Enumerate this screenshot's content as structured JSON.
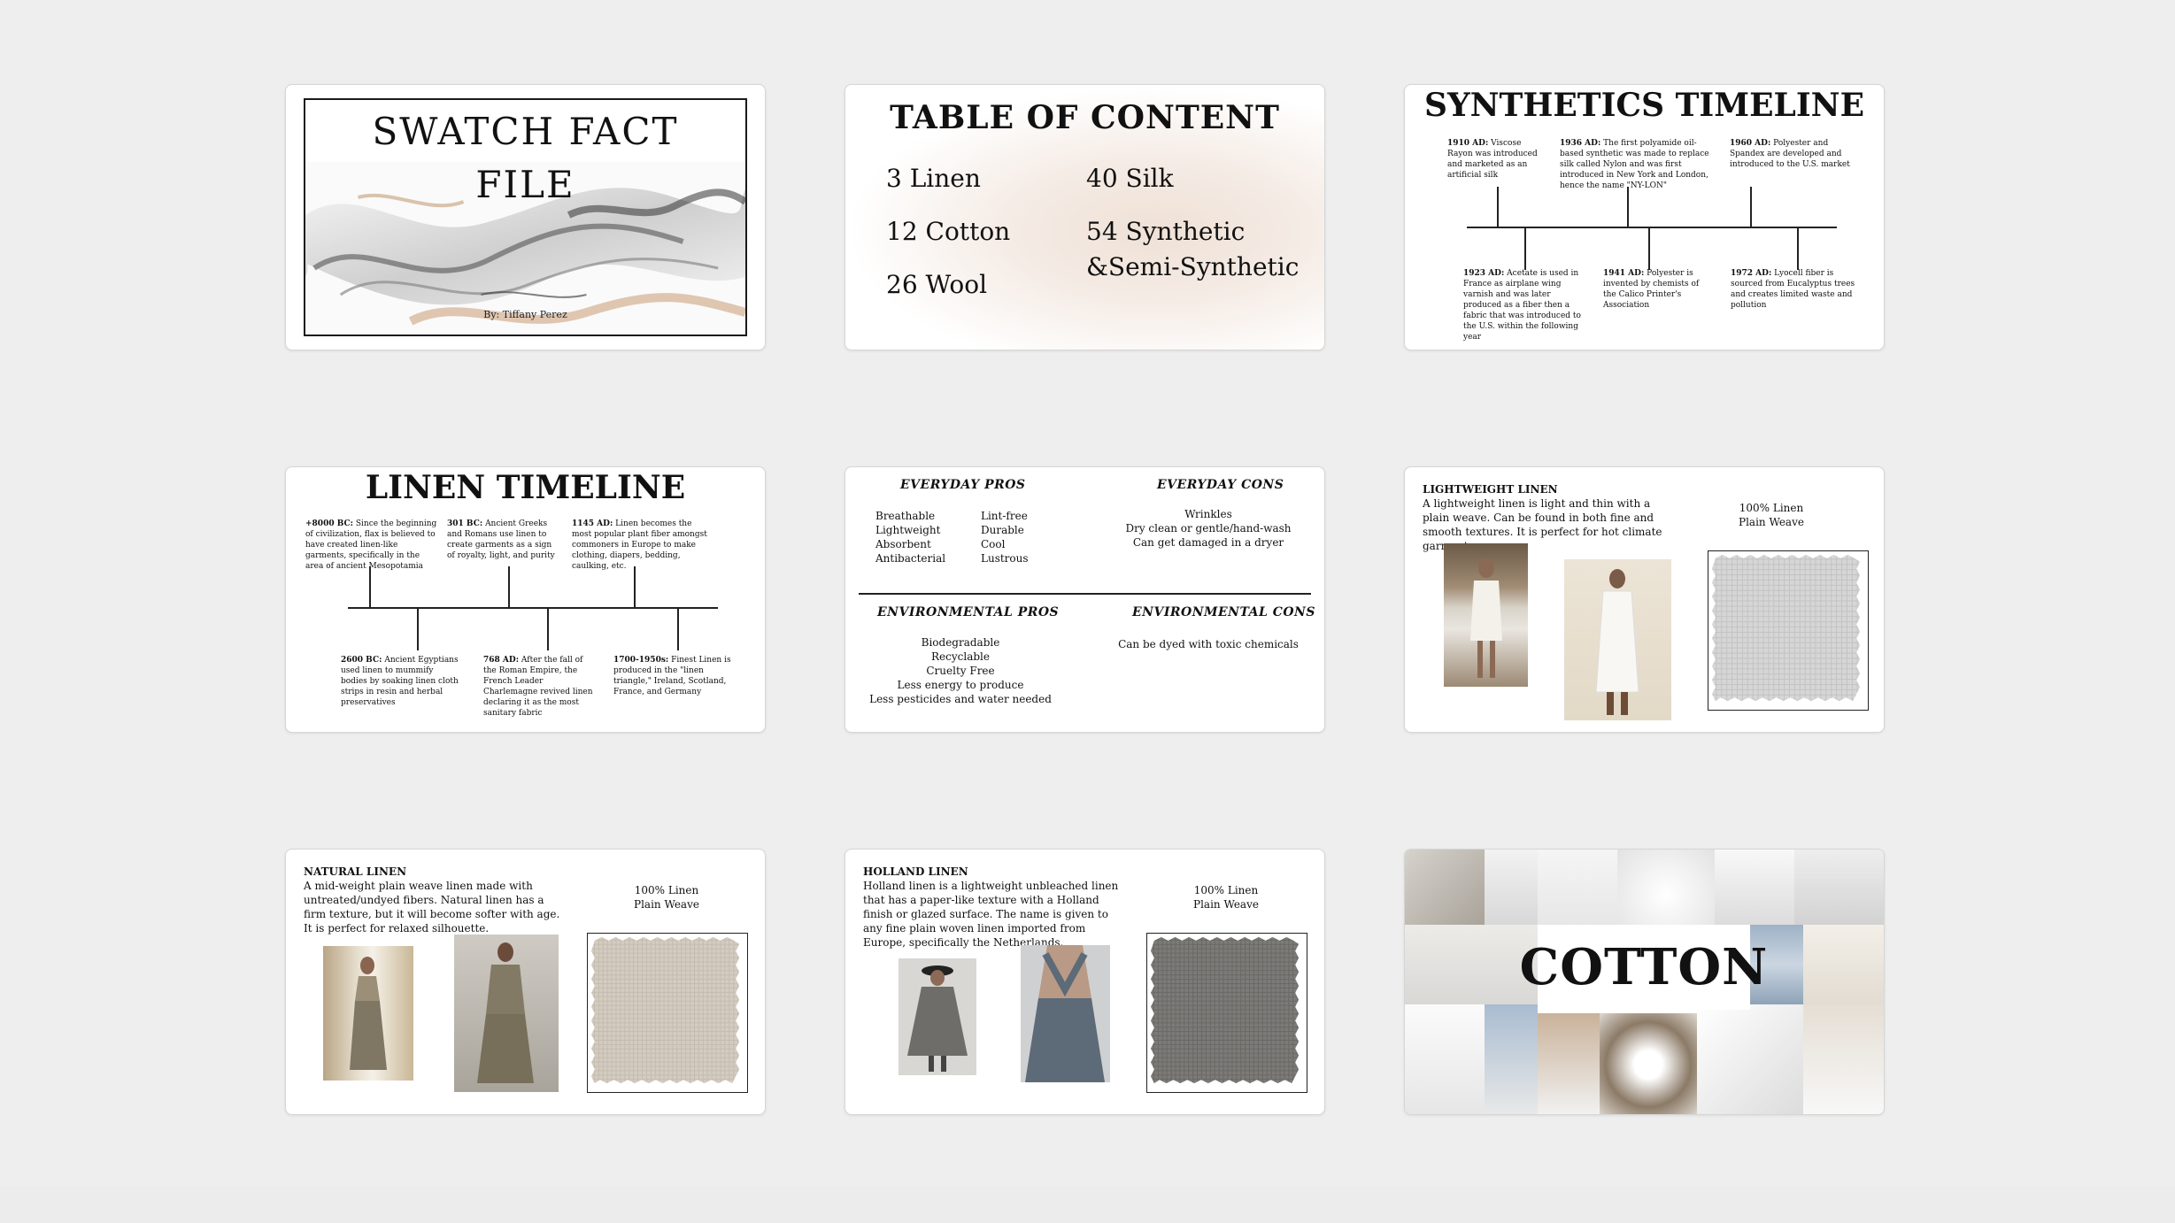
{
  "slides": {
    "s1": {
      "title": "SWATCH FACT FILE",
      "title_line1": "SWATCH FACT",
      "title_line2": "FILE",
      "author": "By: Tiffany Perez"
    },
    "s2": {
      "title": "TABLE OF CONTENT",
      "items": [
        "3 Linen",
        "12 Cotton",
        "26 Wool",
        "40 Silk",
        "54 Synthetic",
        "&Semi-Synthetic"
      ]
    },
    "s3": {
      "title": "SYNTHETICS TIMELINE",
      "top": [
        {
          "date": "1910 AD:",
          "text": "Viscose Rayon was introduced and marketed as an artificial silk"
        },
        {
          "date": "1936 AD:",
          "text": "The first polyamide oil-based synthetic was made to replace silk called Nylon and was first introduced in New York and London, hence the name \"NY-LON\""
        },
        {
          "date": "1960 AD:",
          "text": "Polyester and Spandex are developed and introduced to the U.S. market"
        }
      ],
      "bottom": [
        {
          "date": "1923 AD:",
          "text": "Acetate is used in France as airplane wing varnish and was later produced as a fiber then a fabric that was introduced to the U.S. within the following year"
        },
        {
          "date": "1941 AD:",
          "text": "Polyester is invented by chemists of the Calico Printer's Association"
        },
        {
          "date": "1972 AD:",
          "text": "Lyocell fiber is sourced from Eucalyptus trees and creates limited waste and pollution"
        }
      ]
    },
    "s4": {
      "title": "LINEN TIMELINE",
      "top": [
        {
          "date": "+8000 BC:",
          "text": "Since the beginning of civilization, flax is believed to have created linen-like garments, specifically in the area of ancient Mesopotamia"
        },
        {
          "date": "301 BC:",
          "text": "Ancient Greeks and Romans use linen to create garments as a sign of royalty, light, and purity"
        },
        {
          "date": "1145 AD:",
          "text": "Linen becomes the most popular plant fiber amongst commoners in Europe to make clothing, diapers, bedding, caulking, etc."
        }
      ],
      "bottom": [
        {
          "date": "2600 BC:",
          "text": "Ancient Egyptians used linen to mummify bodies by soaking linen cloth strips in resin and herbal preservatives"
        },
        {
          "date": "768 AD:",
          "text": "After the fall of the Roman Empire, the French Leader Charlemagne revived linen declaring it as the most sanitary fabric"
        },
        {
          "date": "1700-1950s:",
          "text": "Finest Linen is produced in the \"linen triangle,\" Ireland, Scotland, France, and Germany"
        }
      ]
    },
    "s5": {
      "everyday_pros_h": "EVERYDAY PROS",
      "everyday_pros_col1": [
        "Breathable",
        "Lightweight",
        "Absorbent",
        "Antibacterial"
      ],
      "everyday_pros_col2": [
        "Lint-free",
        "Durable",
        "Cool",
        "Lustrous"
      ],
      "everyday_cons_h": "EVERYDAY CONS",
      "everyday_cons": [
        "Wrinkles",
        "Dry clean or gentle/hand-wash",
        "Can get damaged in a dryer"
      ],
      "env_pros_h": "ENVIRONMENTAL PROS",
      "env_pros": [
        "Biodegradable",
        "Recyclable",
        "Cruelty Free",
        "Less energy to produce",
        "Less pesticides and water needed"
      ],
      "env_cons_h": "ENVIRONMENTAL CONS",
      "env_cons": [
        "Can be dyed with toxic chemicals"
      ]
    },
    "s6": {
      "heading": "LIGHTWEIGHT LINEN",
      "desc": "A lightweight linen is light and thin with a plain weave. Can be found in both fine and smooth textures. It is perfect for hot climate garments.",
      "spec1": "100% Linen",
      "spec2": "Plain Weave"
    },
    "s7": {
      "heading": "NATURAL LINEN",
      "desc": "A mid-weight plain weave linen made with untreated/undyed fibers. Natural linen has a firm texture, but it will become softer with age. It is perfect for relaxed silhouette.",
      "spec1": "100% Linen",
      "spec2": "Plain Weave"
    },
    "s8": {
      "heading": "HOLLAND LINEN",
      "desc": "Holland linen is a lightweight unbleached linen that has a paper-like texture with a Holland finish or glazed surface. The name is given to any fine plain woven linen imported from Europe, specifically the Netherlands.",
      "spec1": "100% Linen",
      "spec2": "Plain Weave"
    },
    "s9": {
      "title": "COTTON"
    }
  },
  "colors": {
    "background": "#eeeeee",
    "slide": "#ffffff",
    "light_swatch": "#d8d8d8",
    "natural_swatch": "#d3ccc0",
    "holland_swatch": "#7d7b78"
  }
}
